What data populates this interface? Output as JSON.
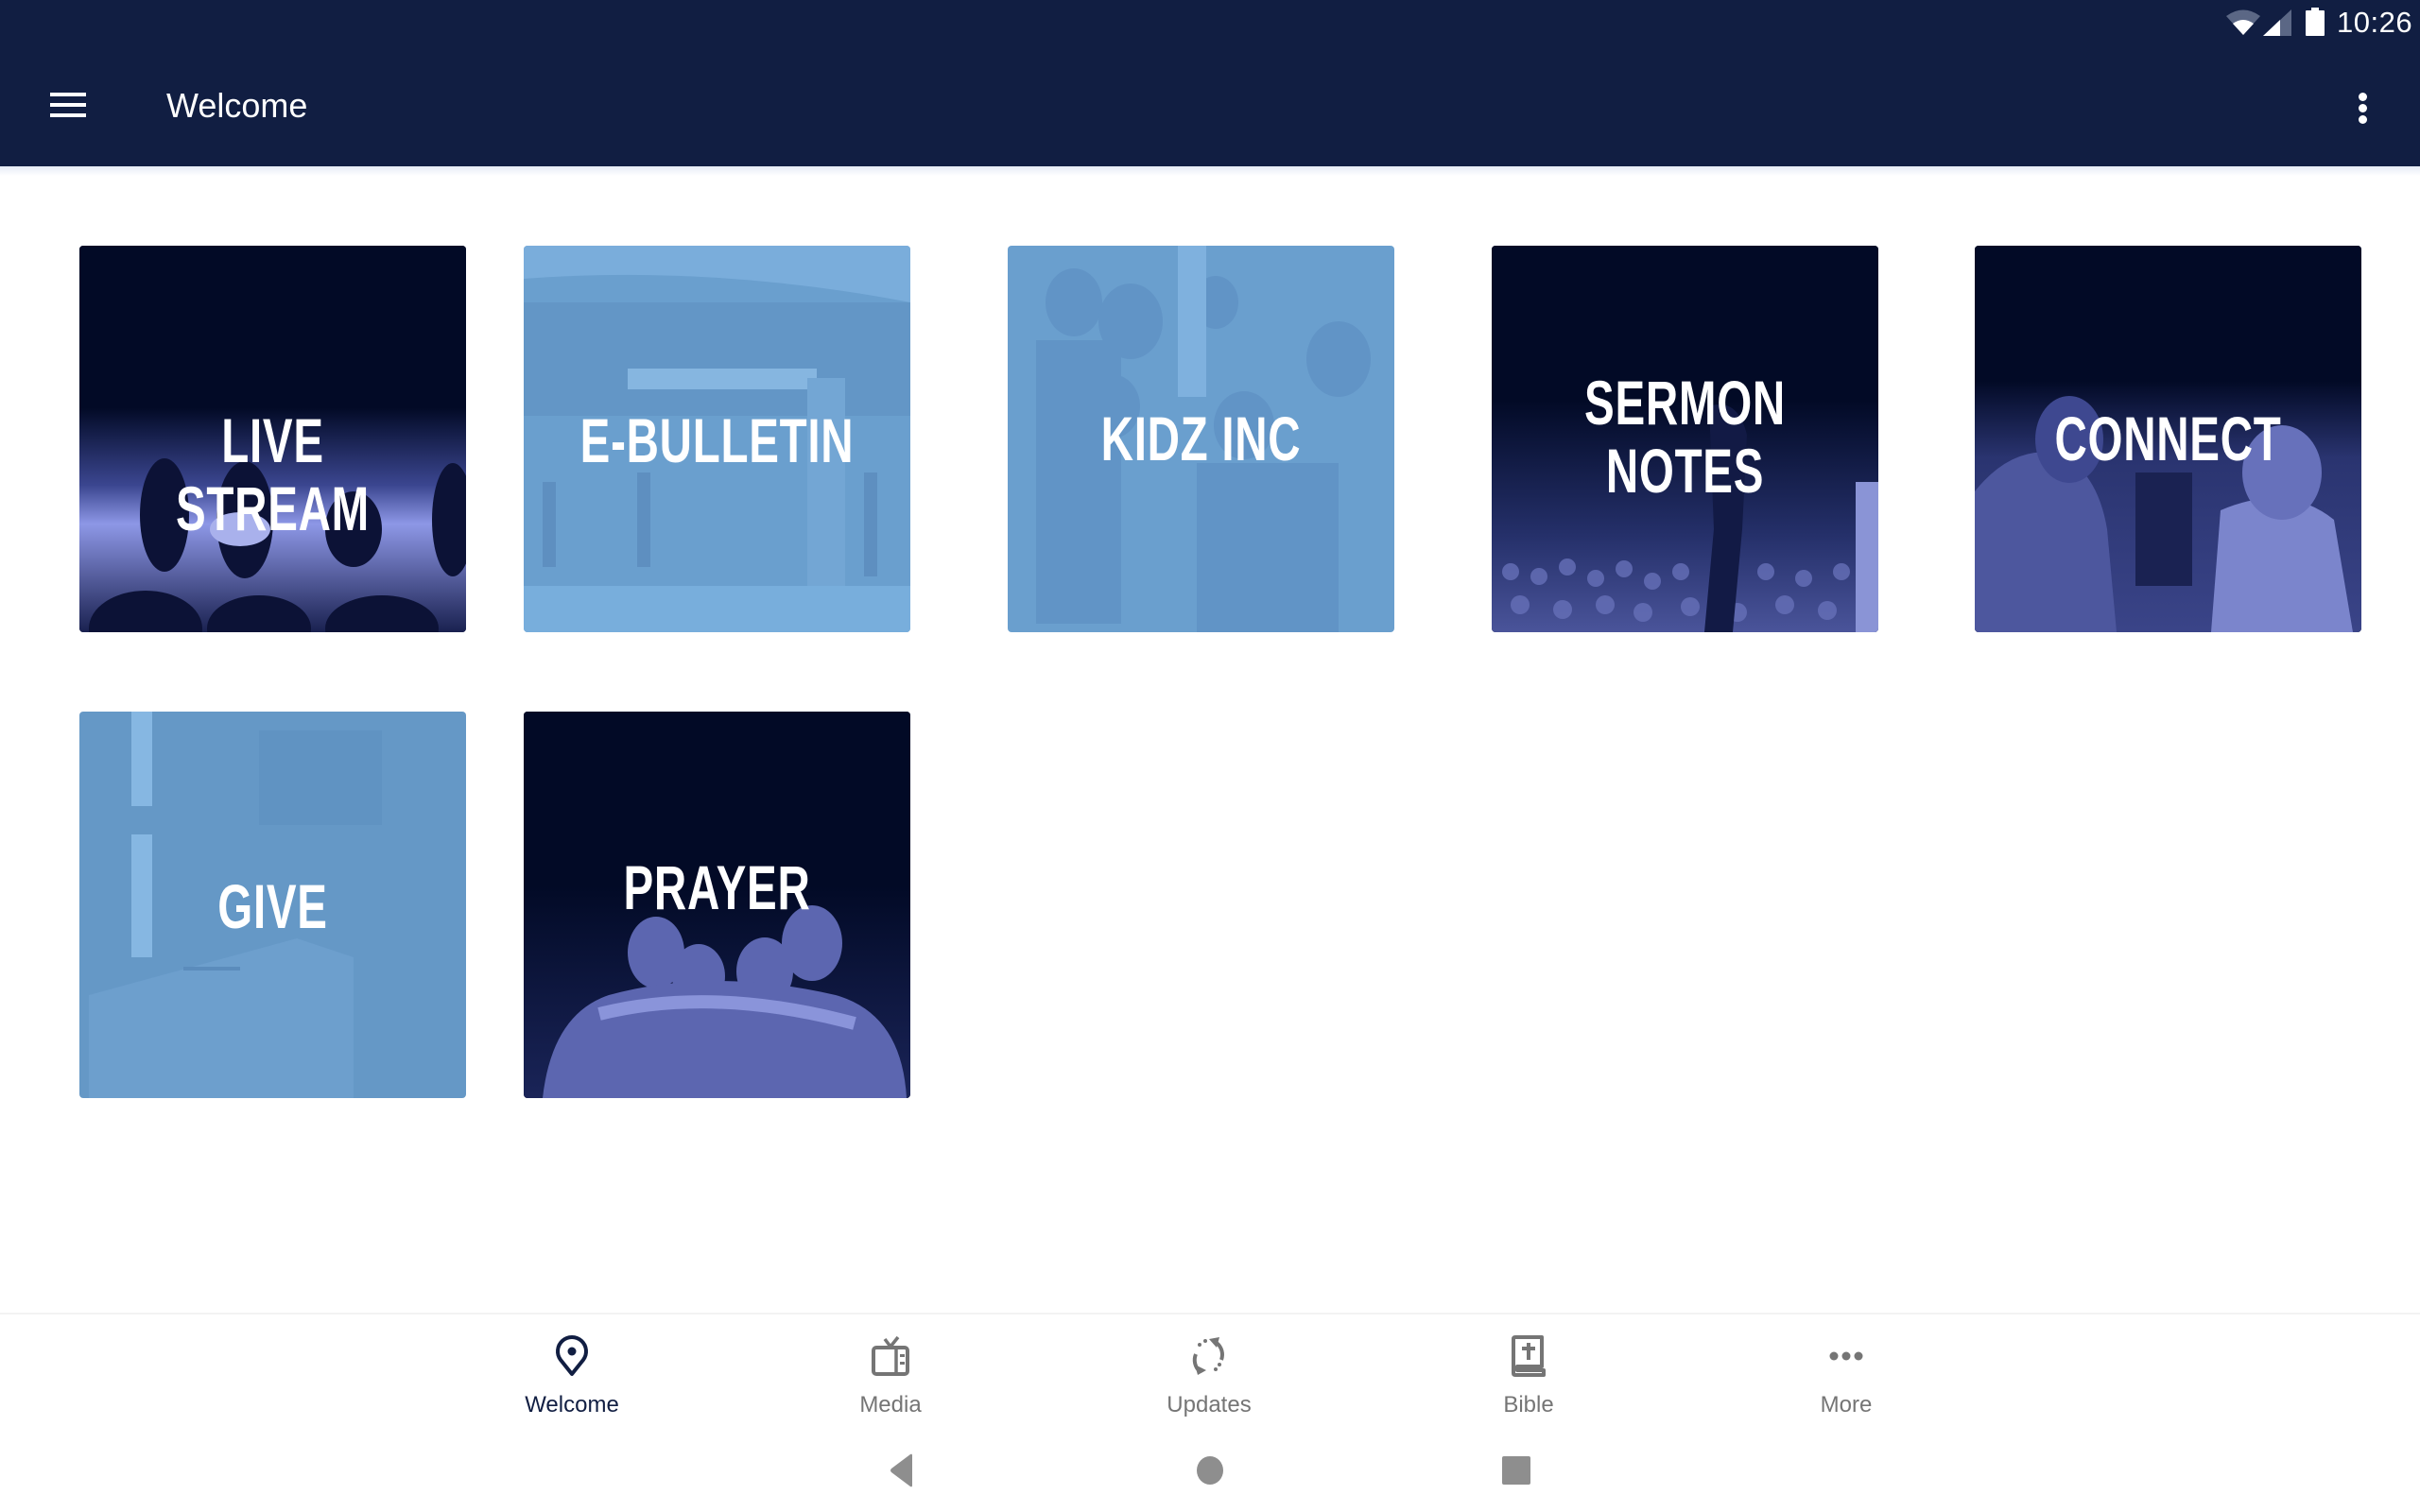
{
  "status_bar": {
    "time": "10:26",
    "icons": [
      "wifi-icon",
      "cellular-signal-icon",
      "battery-icon"
    ]
  },
  "app_bar": {
    "title": "Welcome",
    "menu_icon": "hamburger-menu-icon",
    "overflow_icon": "more-vert-icon"
  },
  "tiles": [
    {
      "label": "LIVE STREAM",
      "style": "dark",
      "image": "band-on-stage"
    },
    {
      "label": "E-BULLETIN",
      "style": "light",
      "image": "church-entrance"
    },
    {
      "label": "KIDZ INC",
      "style": "light",
      "image": "families-group"
    },
    {
      "label": "SERMON\nNOTES",
      "style": "dark",
      "image": "preacher-and-audience"
    },
    {
      "label": "CONNECT",
      "style": "dark",
      "image": "men-shaking-hands"
    },
    {
      "label": "GIVE",
      "style": "light",
      "image": "offering-box"
    },
    {
      "label": "PRAYER",
      "style": "dark",
      "image": "men-praying-huddle"
    }
  ],
  "bottom_nav": {
    "items": [
      {
        "label": "Welcome",
        "icon": "location-pin-icon",
        "active": true
      },
      {
        "label": "Media",
        "icon": "tv-icon",
        "active": false
      },
      {
        "label": "Updates",
        "icon": "sync-icon",
        "active": false
      },
      {
        "label": "Bible",
        "icon": "bible-icon",
        "active": false
      },
      {
        "label": "More",
        "icon": "more-horiz-icon",
        "active": false
      }
    ]
  },
  "system_nav": {
    "buttons": [
      "back",
      "home",
      "recents"
    ]
  },
  "colors": {
    "primary": "#111e42",
    "tile_dark": "#020a26",
    "tile_light": "#6a9fce",
    "nav_inactive": "#757575"
  }
}
